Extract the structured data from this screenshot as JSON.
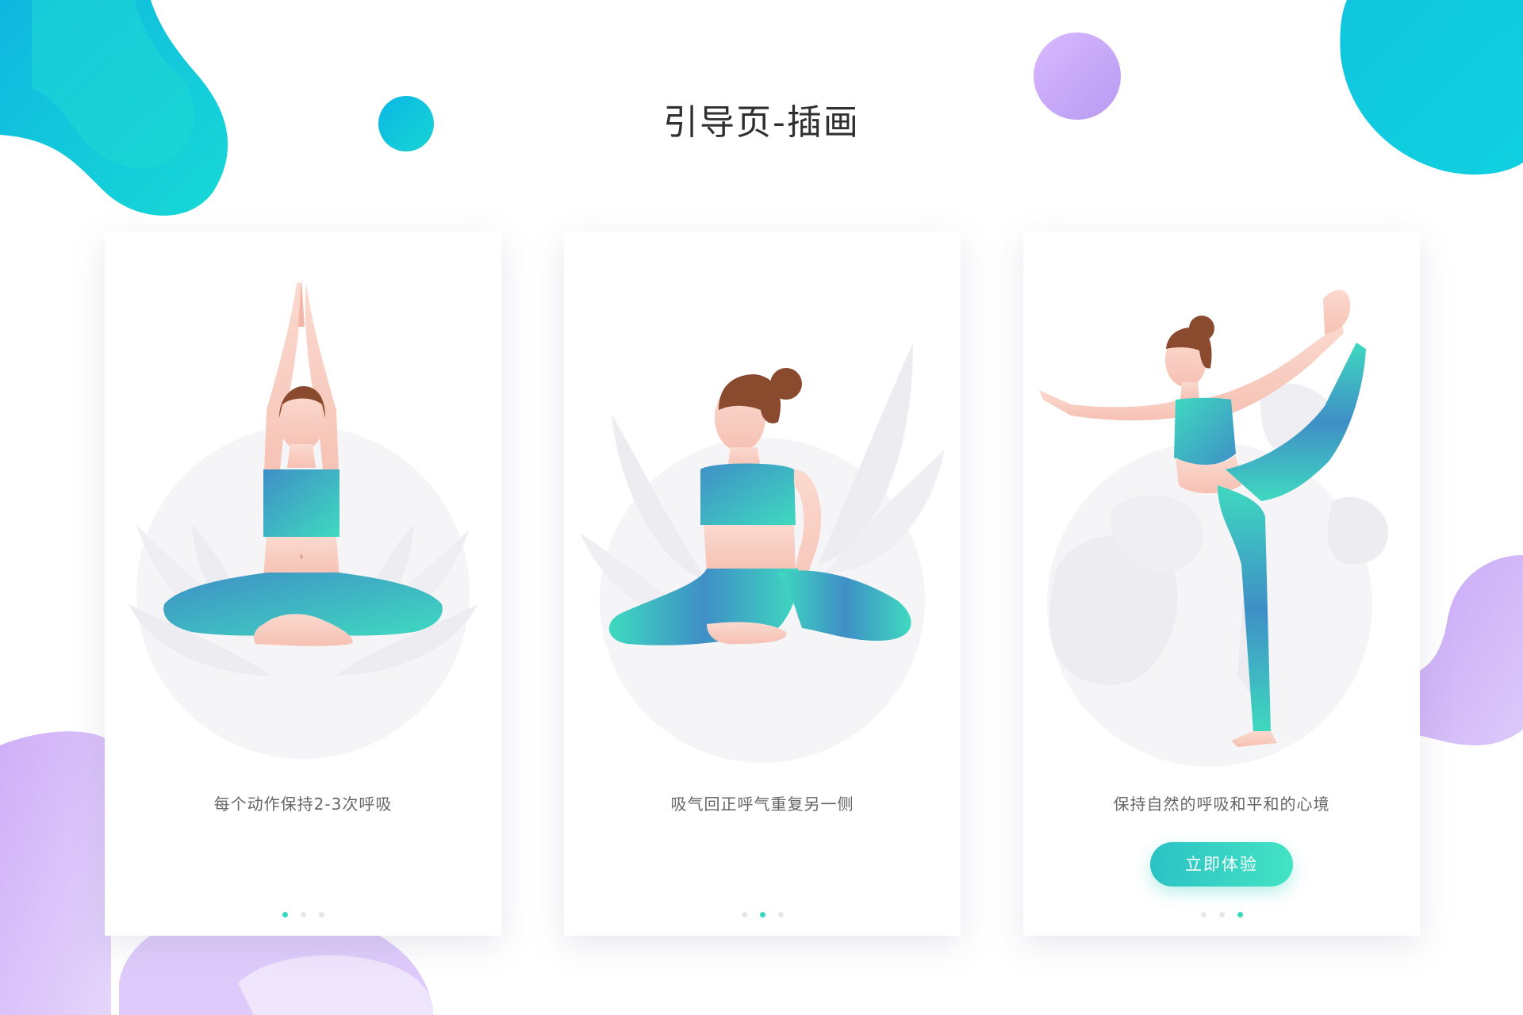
{
  "page": {
    "title": "引导页-插画"
  },
  "colors": {
    "accent": "#3bd6c0",
    "teal": "#12c6de",
    "purple": "#c6a8f6",
    "dot_inactive": "#e6e6ea"
  },
  "cards": [
    {
      "caption": "每个动作保持2-3次呼吸",
      "active_dot": 1
    },
    {
      "caption": "吸气回正呼气重复另一侧",
      "active_dot": 2
    },
    {
      "caption": "保持自然的呼吸和平和的心境",
      "active_dot": 3,
      "button_label": "立即体验"
    }
  ],
  "pagination": {
    "total": 3
  }
}
